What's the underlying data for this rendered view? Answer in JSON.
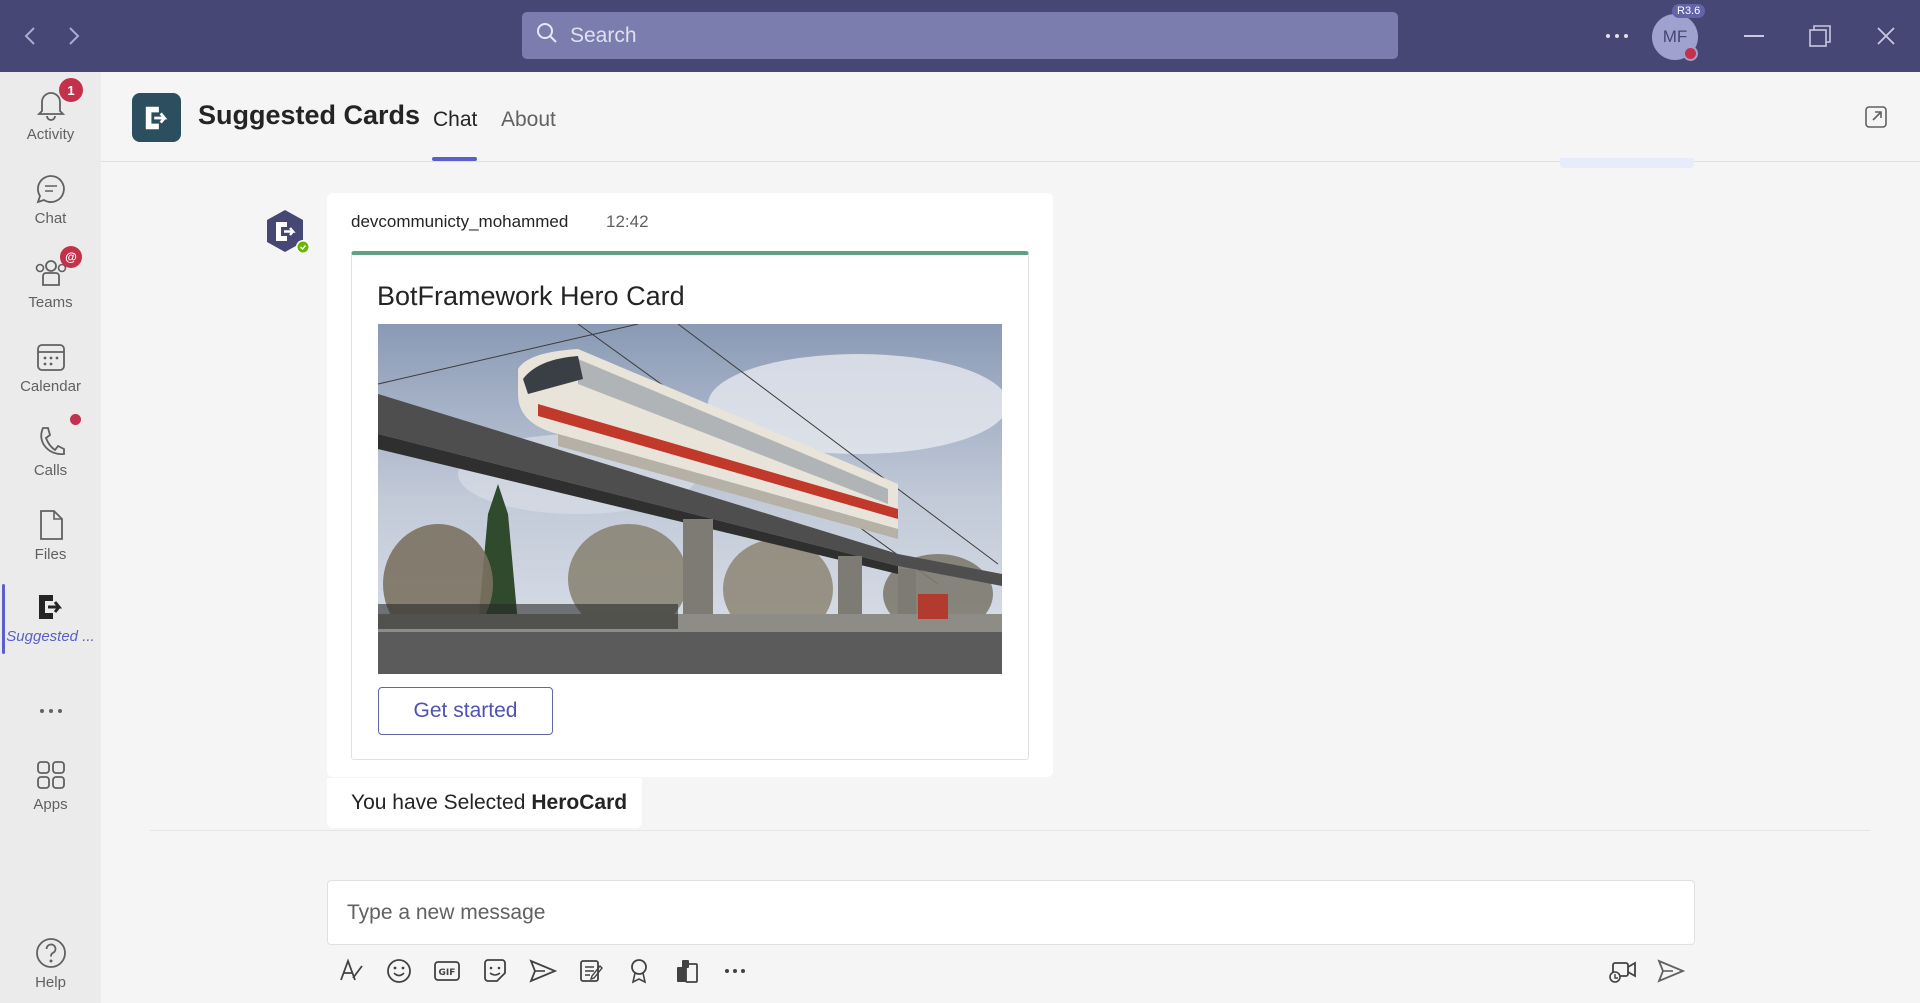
{
  "titlebar": {
    "search_placeholder": "Search",
    "avatar_initials": "MF",
    "version_badge": "R3.6"
  },
  "rail": {
    "items": [
      {
        "label": "Activity",
        "badge": "1"
      },
      {
        "label": "Chat"
      },
      {
        "label": "Teams",
        "badge": "@"
      },
      {
        "label": "Calendar"
      },
      {
        "label": "Calls"
      },
      {
        "label": "Files"
      },
      {
        "label": "Suggested ..."
      },
      {
        "label": "Apps"
      },
      {
        "label": "Help"
      }
    ]
  },
  "header": {
    "app_title": "Suggested Cards",
    "tabs": [
      {
        "label": "Chat"
      },
      {
        "label": "About"
      }
    ]
  },
  "message": {
    "sender": "devcommunicty_mohammed",
    "time": "12:42",
    "card_title": "BotFramework Hero Card",
    "button_label": "Get started"
  },
  "reply": {
    "prefix": "You have Selected",
    "bold": "HeroCard"
  },
  "compose": {
    "placeholder": "Type a new message"
  },
  "colors": {
    "titlebar": "#464775",
    "accent": "#5b5fc7",
    "card_border": "#5fa086",
    "badge_red": "#c4314b"
  }
}
